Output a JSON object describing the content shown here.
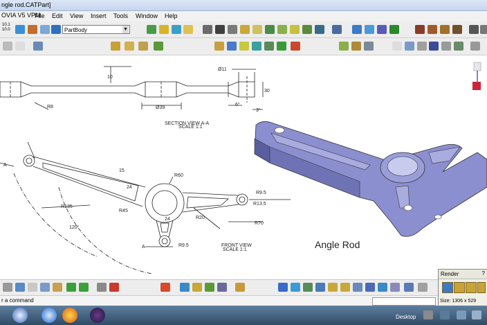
{
  "window": {
    "title": "ngle rod.CATPart]"
  },
  "menubar": {
    "app_label": "OVIA V5 VPM",
    "items": [
      "File",
      "Edit",
      "View",
      "Insert",
      "Tools",
      "Window",
      "Help"
    ]
  },
  "toolbar": {
    "version_top": "10.1",
    "version_bottom": "10.0",
    "body_combo": "PartBody"
  },
  "drawing": {
    "section_label": "SECTION VIEW A-A",
    "section_scale": "SCALE 1:1",
    "front_label": "FRONT VIEW",
    "front_scale": "SCALE 1:1",
    "part_name": "Angle Rod",
    "dimensions": {
      "d10": "10",
      "d11": "Ø11",
      "d30": "30",
      "d39": "Ø39",
      "d6": "6°",
      "d3": "3°",
      "r8": "R8",
      "r60": "R60",
      "r13_5": "R13.5",
      "r9_5": "R9.5",
      "r135": "R135",
      "r45": "R45",
      "r70": "R70",
      "r20": "R20",
      "r95": "R9.5",
      "d24": "24",
      "d24b": "24",
      "a120": "120°",
      "a15": "15",
      "aA": "A",
      "aA2": "A"
    }
  },
  "statusbar": {
    "command_prompt": "r a command"
  },
  "render_panel": {
    "title": "Render",
    "help": "?",
    "size": "Size: 1306 x 529"
  },
  "taskbar": {
    "desktop_label": "Desktop"
  },
  "colors": {
    "part_fill": "#8b8fcf",
    "part_dark": "#5a5e9e",
    "drawing_line": "#222222"
  }
}
